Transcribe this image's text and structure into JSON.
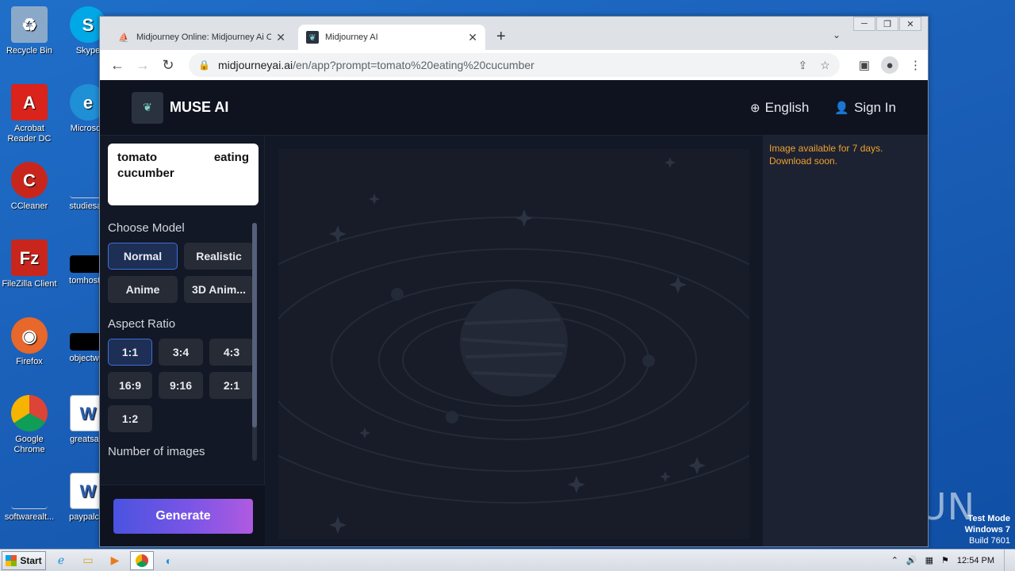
{
  "desktop": {
    "icons": [
      {
        "label": "Recycle Bin",
        "icon": "recycle-bin-icon",
        "color": "#8aa9c9",
        "glyph": "♻"
      },
      {
        "label": "Acrobat Reader DC",
        "icon": "acrobat-reader-icon",
        "color": "#d9231b",
        "glyph": "A"
      },
      {
        "label": "CCleaner",
        "icon": "ccleaner-icon",
        "color": "#c8261c",
        "glyph": "C"
      },
      {
        "label": "FileZilla Client",
        "icon": "filezilla-icon",
        "color": "#c8261c",
        "glyph": "Fz"
      },
      {
        "label": "Firefox",
        "icon": "firefox-icon",
        "color": "#e8672a",
        "glyph": "◉"
      },
      {
        "label": "Google Chrome",
        "icon": "chrome-icon",
        "color": "#2f8d47",
        "glyph": "◎"
      },
      {
        "label": "softwarealt...",
        "icon": "file-icon",
        "color": "#f0f0f0",
        "glyph": ""
      }
    ],
    "icons_col2": [
      {
        "label": "Skype",
        "icon": "skype-icon",
        "color": "#00a8e6",
        "glyph": "S"
      },
      {
        "label": "Microsoft",
        "icon": "edge-icon",
        "color": "#1f8fd6",
        "glyph": "e"
      },
      {
        "label": "studiesag",
        "icon": "file-icon",
        "color": "#ffffff",
        "glyph": ""
      },
      {
        "label": "tomhostin",
        "icon": "file-icon",
        "color": "#000000",
        "glyph": ""
      },
      {
        "label": "objectwor",
        "icon": "file-icon",
        "color": "#000000",
        "glyph": ""
      },
      {
        "label": "greatsafe",
        "icon": "word-doc-icon",
        "color": "#2b5fb4",
        "glyph": "W"
      },
      {
        "label": "paypalcar",
        "icon": "word-doc-icon",
        "color": "#2b5fb4",
        "glyph": "W"
      }
    ],
    "watermark": "ANY ▷ RUN",
    "os_lines": [
      "Test Mode",
      "Windows 7",
      "Build 7601"
    ]
  },
  "browser": {
    "tabs": [
      {
        "title": "Midjourney Online: Midjourney Ai On",
        "icon": "sailboat-icon"
      },
      {
        "title": "Midjourney AI",
        "icon": "muse-favicon-icon"
      }
    ],
    "new_tab_glyph": "+",
    "url_host": "midjourneyai.ai",
    "url_path": "/en/app?prompt=tomato%20eating%20cucumber"
  },
  "site": {
    "brand": "MUSE AI",
    "logo_glyph": "❦",
    "language": "English",
    "signin": "Sign In",
    "prompt": "tomato eating cucumber",
    "choose_model_title": "Choose Model",
    "models": [
      "Normal",
      "Realistic",
      "Anime",
      "3D Anim..."
    ],
    "selected_model": "Normal",
    "aspect_title": "Aspect Ratio",
    "ratios": [
      "1:1",
      "3:4",
      "4:3",
      "16:9",
      "9:16",
      "2:1",
      "1:2"
    ],
    "selected_ratio": "1:1",
    "num_images_title": "Number of images",
    "generate": "Generate",
    "notice": "Image available for 7 days. Download soon."
  },
  "taskbar": {
    "start": "Start",
    "clock": "12:54 PM"
  },
  "colors": {
    "accent_selected": "#3f6fd8",
    "notice": "#f0a030",
    "generate_from": "#4a53e0",
    "generate_to": "#b05ae0"
  }
}
